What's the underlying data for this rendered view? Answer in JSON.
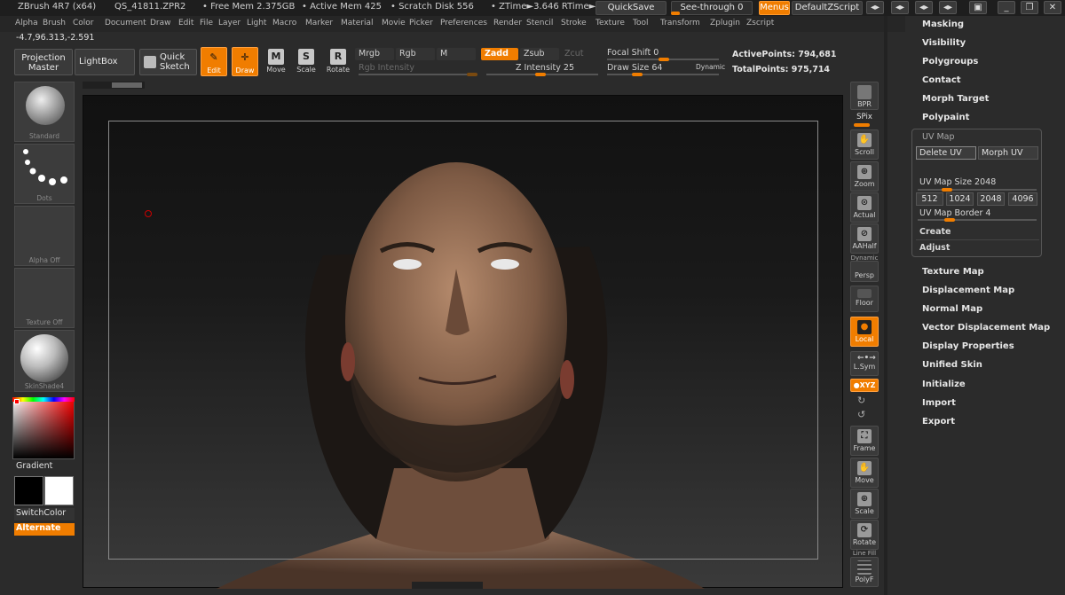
{
  "titlebar": {
    "app": "ZBrush 4R7 (x64)",
    "file": "QS_41811.ZPR2",
    "free_mem": "• Free Mem 2.375GB",
    "active_mem": "• Active Mem 425",
    "scratch": "• Scratch Disk 556",
    "ztime": "• ZTime►3.646 RTime►",
    "quicksave": "QuickSave",
    "seethrough": "See-through  0",
    "menus": "Menus",
    "script": "DefaultZScript"
  },
  "menubar": [
    "Alpha",
    "Brush",
    "Color",
    "Document",
    "Draw",
    "Edit",
    "File",
    "Layer",
    "Light",
    "Macro",
    "Marker",
    "Material",
    "Movie",
    "Picker",
    "Preferences",
    "Render",
    "Stencil",
    "Stroke",
    "Texture",
    "Tool",
    "Transform",
    "Zplugin",
    "Zscript"
  ],
  "coords": "-4.7,96.313,-2.591",
  "toolbar": {
    "projection_master": "Projection Master",
    "lightbox": "LightBox",
    "quick_sketch": "Quick Sketch",
    "edit": "Edit",
    "draw": "Draw",
    "move": "Move",
    "scale": "Scale",
    "rotate": "Rotate",
    "mrgb": "Mrgb",
    "rgb": "Rgb",
    "m": "M",
    "rgb_intensity": "Rgb Intensity",
    "zadd": "Zadd",
    "zsub": "Zsub",
    "zcut": "Zcut",
    "z_intensity": "Z Intensity 25",
    "focal_shift": "Focal Shift 0",
    "draw_size": "Draw Size 64",
    "dynamic": "Dynamic",
    "active_points": "ActivePoints: 794,681",
    "total_points": "TotalPoints: 975,714"
  },
  "lefttray": {
    "brush": "Standard",
    "stroke": "Dots",
    "alpha": "Alpha Off",
    "texture": "Texture Off",
    "material": "SkinShade4",
    "gradient": "Gradient",
    "switchcolor": "SwitchColor",
    "alternate": "Alternate"
  },
  "righttray": {
    "bpr": "BPR",
    "spix": "SPix",
    "scroll": "Scroll",
    "zoom": "Zoom",
    "actual": "Actual",
    "aahalf": "AAHalf",
    "dynamic": "Dynamic",
    "persp": "Persp",
    "floor": "Floor",
    "local": "Local",
    "lsym": "L.Sym",
    "xyz": "●XYZ",
    "frame": "Frame",
    "move": "Move",
    "scale": "Scale",
    "rotate": "Rotate",
    "linefill": "Line Fill",
    "polyf": "PolyF"
  },
  "rightmenu": {
    "top": [
      "Masking",
      "Visibility",
      "Polygroups",
      "Contact",
      "Morph Target",
      "Polypaint"
    ],
    "uvmap": {
      "title": "UV Map",
      "delete_uv": "Delete UV",
      "morph_uv": "Morph UV",
      "size": "UV Map Size 2048",
      "sizes": [
        "512",
        "1024",
        "2048",
        "4096"
      ],
      "border": "UV Map Border 4",
      "create": "Create",
      "adjust": "Adjust"
    },
    "bottom": [
      "Texture Map",
      "Displacement Map",
      "Normal Map",
      "Vector Displacement Map",
      "Display Properties",
      "Unified Skin",
      "Initialize",
      "Import",
      "Export"
    ]
  },
  "colors": {
    "accent": "#f07d00",
    "panel": "#2b2b2b",
    "canvas": "#1a1a1a"
  }
}
